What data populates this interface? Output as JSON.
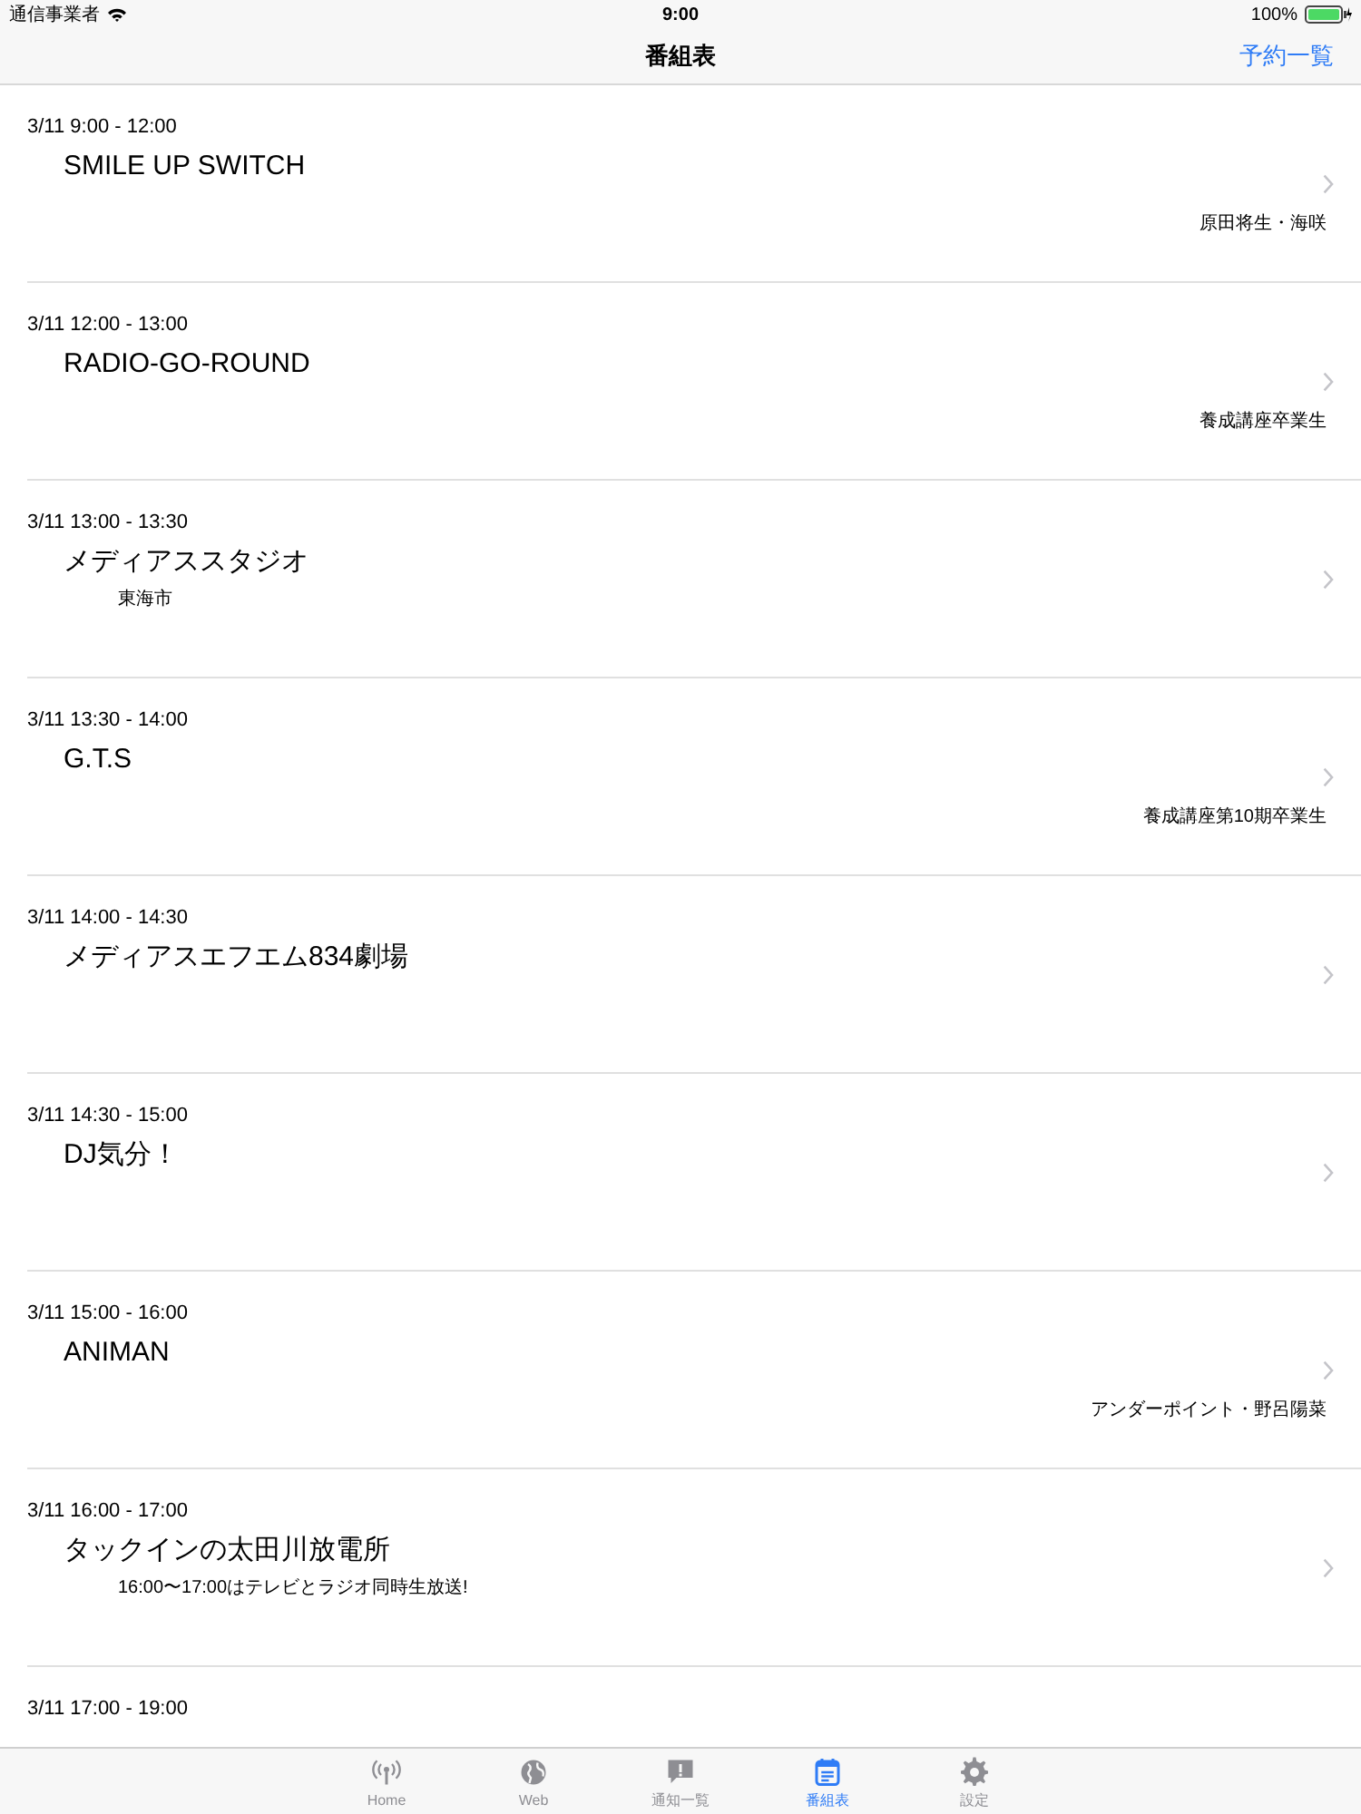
{
  "status_bar": {
    "carrier": "通信事業者",
    "time": "9:00",
    "battery": "100%"
  },
  "nav": {
    "title": "番組表",
    "action": "予約一覧"
  },
  "programs": [
    {
      "time": "3/11 9:00 - 12:00",
      "title": "SMILE UP SWITCH",
      "performers": "原田将生・海咲"
    },
    {
      "time": "3/11 12:00 - 13:00",
      "title": "RADIO-GO-ROUND",
      "performers": "養成講座卒業生"
    },
    {
      "time": "3/11 13:00 - 13:30",
      "title": "メディアススタジオ",
      "subtitle": "東海市"
    },
    {
      "time": "3/11 13:30 - 14:00",
      "title": "G.T.S",
      "performers": "養成講座第10期卒業生"
    },
    {
      "time": "3/11 14:00 - 14:30",
      "title": "メディアスエフエム834劇場"
    },
    {
      "time": "3/11 14:30 - 15:00",
      "title": "DJ気分！"
    },
    {
      "time": "3/11 15:00 - 16:00",
      "title": "ANIMAN",
      "performers": "アンダーポイント・野呂陽菜"
    },
    {
      "time": "3/11 16:00 - 17:00",
      "title": "タックインの太田川放電所",
      "subtitle": "16:00〜17:00はテレビとラジオ同時生放送!"
    },
    {
      "time": "3/11 17:00 - 19:00"
    }
  ],
  "tabs": [
    {
      "kind": "radio",
      "label": "Home",
      "selected": false
    },
    {
      "kind": "globe",
      "label": "Web",
      "selected": false
    },
    {
      "kind": "alert",
      "label": "通知一覧",
      "selected": false
    },
    {
      "kind": "calendar",
      "label": "番組表",
      "selected": true
    },
    {
      "kind": "gear",
      "label": "設定",
      "selected": false
    }
  ]
}
